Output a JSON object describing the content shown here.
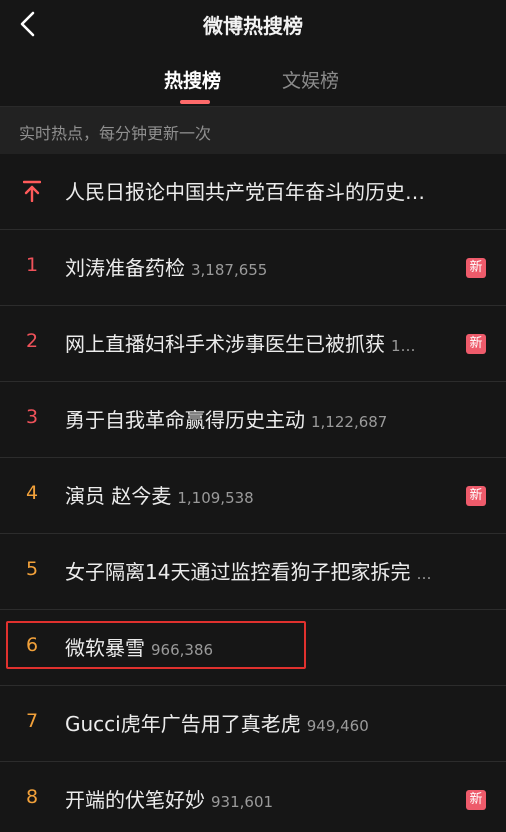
{
  "header": {
    "title": "微博热搜榜"
  },
  "tabs": [
    {
      "label": "热搜榜",
      "active": true
    },
    {
      "label": "文娱榜",
      "active": false
    }
  ],
  "subheader": {
    "text": "实时热点，每分钟更新一次"
  },
  "colors": {
    "accent": "#ff6a6a",
    "rank_red": "#f0525a",
    "rank_orange": "#f2a13a",
    "badge": "#ee5b6b",
    "highlight": "#e0312e"
  },
  "items": [
    {
      "rank": "",
      "rank_icon": "pin-top-icon",
      "title": "人民日报论中国共产党百年奋斗的历史…",
      "count": "",
      "badge": ""
    },
    {
      "rank": "1",
      "title": "刘涛准备药检",
      "count": "3,187,655",
      "badge": "新"
    },
    {
      "rank": "2",
      "title": "网上直播妇科手术涉事医生已被抓获",
      "count": "1…",
      "badge": "新"
    },
    {
      "rank": "3",
      "title": "勇于自我革命赢得历史主动",
      "count": "1,122,687",
      "badge": ""
    },
    {
      "rank": "4",
      "title": "演员 赵今麦",
      "count": "1,109,538",
      "badge": "新"
    },
    {
      "rank": "5",
      "title": "女子隔离14天通过监控看狗子把家拆完",
      "count": "…",
      "badge": ""
    },
    {
      "rank": "6",
      "title": "微软暴雪",
      "count": "966,386",
      "badge": ""
    },
    {
      "rank": "7",
      "title": "Gucci虎年广告用了真老虎",
      "count": "949,460",
      "badge": ""
    },
    {
      "rank": "8",
      "title": "开端的伏笔好妙",
      "count": "931,601",
      "badge": "新"
    }
  ]
}
